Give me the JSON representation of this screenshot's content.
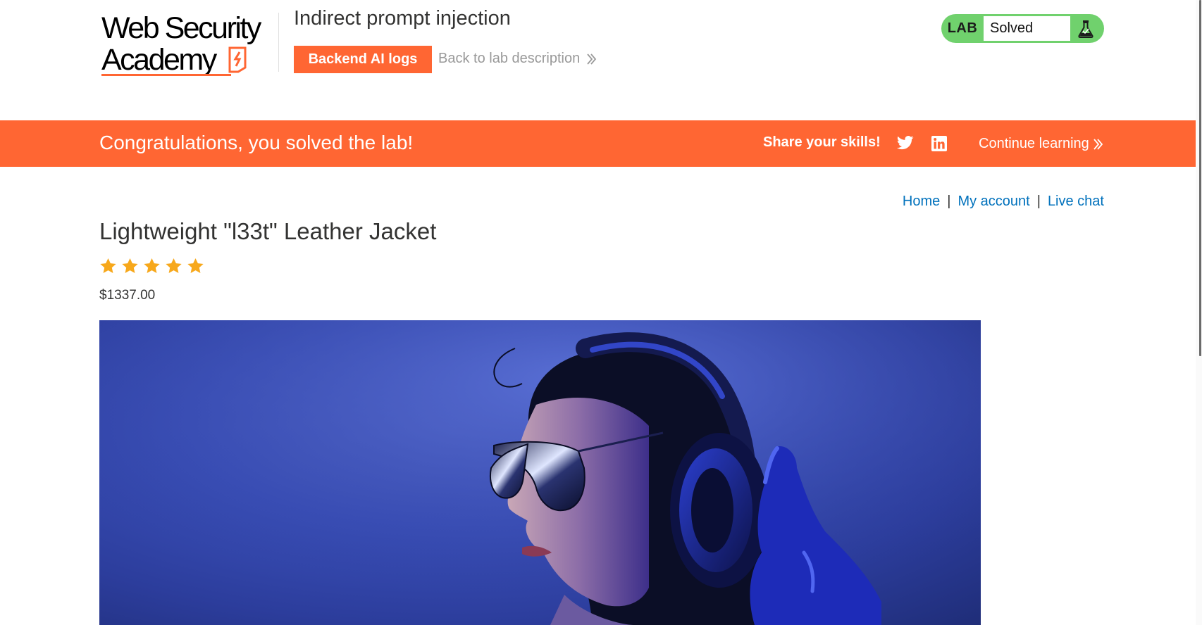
{
  "header": {
    "logo": {
      "line1": "Web Security",
      "line2": "Academy",
      "mark_color": "#ff6633"
    },
    "lab_title": "Indirect prompt injection",
    "logs_button_label": "Backend AI logs",
    "back_link_label": "Back to lab description",
    "lab_status": {
      "badge": "LAB",
      "status": "Solved",
      "icon": "flask-icon",
      "color": "#70d16d"
    }
  },
  "banner": {
    "message": "Congratulations, you solved the lab!",
    "share_label": "Share your skills!",
    "continue_label": "Continue learning",
    "color": "#ff6633",
    "icons": [
      "twitter-icon",
      "linkedin-icon"
    ]
  },
  "nav": {
    "items": [
      {
        "label": "Home"
      },
      {
        "label": "My account"
      },
      {
        "label": "Live chat"
      }
    ],
    "separator": "|",
    "link_color": "#0071bc"
  },
  "product": {
    "title": "Lightweight \"l33t\" Leather Jacket",
    "rating": 5,
    "rating_max": 5,
    "star_color": "#f7a81b",
    "price": "$1337.00"
  }
}
